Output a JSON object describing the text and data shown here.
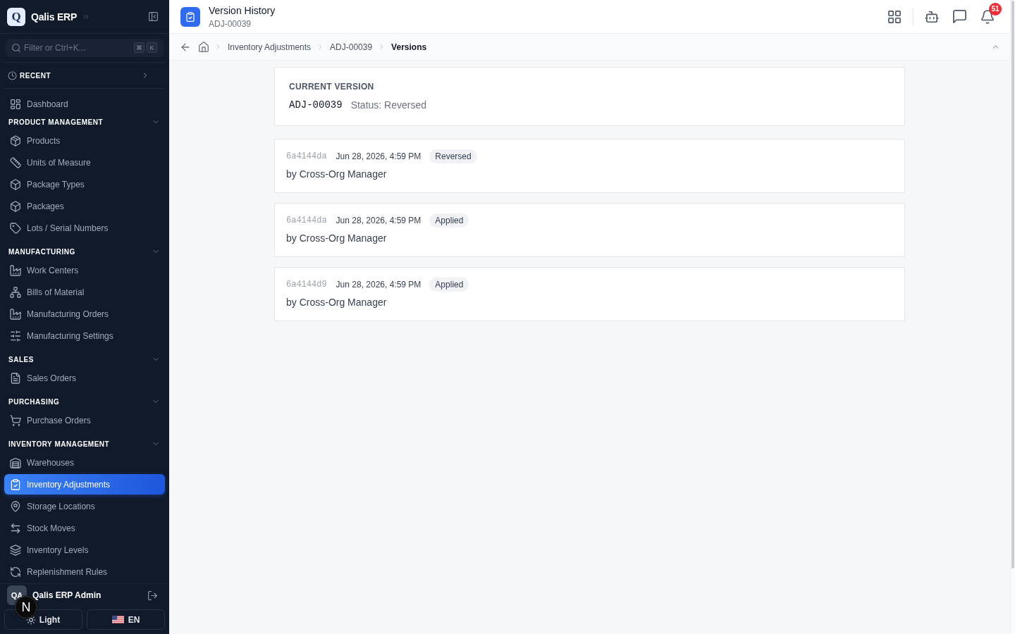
{
  "sidebar": {
    "brand": {
      "logo": "Q",
      "name": "Qalis ERP"
    },
    "search": {
      "placeholder": "Filter or Ctrl+K...",
      "keys": [
        "⌘",
        "K"
      ]
    },
    "recent": {
      "label": "RECENT",
      "expanded": false
    },
    "nav": [
      {
        "kind": "link",
        "label": "Dashboard",
        "selected": false
      },
      {
        "kind": "section",
        "label": "PRODUCT MANAGEMENT",
        "expanded": true,
        "children": [
          {
            "label": "Products",
            "selected": false
          },
          {
            "label": "Units of Measure",
            "selected": false
          },
          {
            "label": "Package Types",
            "selected": false
          },
          {
            "label": "Packages",
            "selected": false
          },
          {
            "label": "Lots / Serial Numbers",
            "selected": false
          }
        ]
      },
      {
        "kind": "section",
        "label": "MANUFACTURING",
        "expanded": true,
        "children": [
          {
            "label": "Work Centers",
            "selected": false
          },
          {
            "label": "Bills of Material",
            "selected": false
          },
          {
            "label": "Manufacturing Orders",
            "selected": false
          },
          {
            "label": "Manufacturing Settings",
            "selected": false
          }
        ]
      },
      {
        "kind": "section",
        "label": "SALES",
        "expanded": true,
        "children": [
          {
            "label": "Sales Orders",
            "selected": false
          }
        ]
      },
      {
        "kind": "section",
        "label": "PURCHASING",
        "expanded": true,
        "children": [
          {
            "label": "Purchase Orders",
            "selected": false
          }
        ]
      },
      {
        "kind": "section",
        "label": "INVENTORY MANAGEMENT",
        "expanded": true,
        "children": [
          {
            "label": "Warehouses",
            "selected": false
          },
          {
            "label": "Inventory Adjustments",
            "selected": true
          },
          {
            "label": "Storage Locations",
            "selected": false
          },
          {
            "label": "Stock Moves",
            "selected": false
          },
          {
            "label": "Inventory Levels",
            "selected": false
          },
          {
            "label": "Replenishment Rules",
            "selected": false
          }
        ]
      }
    ],
    "user": {
      "initials": "QA",
      "name": "Qalis ERP Admin"
    },
    "theme_button": {
      "label": "Light"
    },
    "language_button": {
      "label": "EN"
    }
  },
  "dev_indicator": {
    "label": "N"
  },
  "header": {
    "title": "Version History",
    "subtitle": "ADJ-00039",
    "notification_count": "51"
  },
  "breadcrumb": [
    {
      "label": "Inventory Adjustments",
      "current": false
    },
    {
      "label": "ADJ-00039",
      "current": false
    },
    {
      "label": "Versions",
      "current": true
    }
  ],
  "current_version": {
    "heading": "CURRENT VERSION",
    "number": "ADJ-00039",
    "status": "Status: Reversed"
  },
  "versions": [
    {
      "hash": "6a4144da",
      "date": "Jun 28, 2026, 4:59 PM",
      "status": "Reversed",
      "author": "by Cross-Org Manager"
    },
    {
      "hash": "6a4144da",
      "date": "Jun 28, 2026, 4:59 PM",
      "status": "Applied",
      "author": "by Cross-Org Manager"
    },
    {
      "hash": "6a4144d9",
      "date": "Jun 28, 2026, 4:59 PM",
      "status": "Applied",
      "author": "by Cross-Org Manager"
    }
  ]
}
